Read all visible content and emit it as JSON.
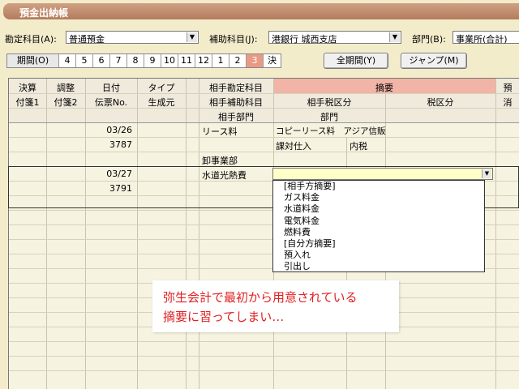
{
  "title": "預金出納帳",
  "fields": {
    "account_label": "勘定科目(A):",
    "account_value": "普通預金",
    "sub_label": "補助科目(J):",
    "sub_value": "港銀行 城西支店",
    "dept_label": "部門(B):",
    "dept_value": "事業所(合計)"
  },
  "period": {
    "label": "期間(O)",
    "months": [
      "4",
      "5",
      "6",
      "7",
      "8",
      "9",
      "10",
      "11",
      "12",
      "1",
      "2",
      "3",
      "決"
    ],
    "selected": "3"
  },
  "buttons": {
    "all_period": "全期間(Y)",
    "jump": "ジャンプ(M)"
  },
  "columns": {
    "row1": [
      "決算",
      "調整",
      "日付",
      "タイプ",
      "相手勘定科目",
      "摘要"
    ],
    "row2": [
      "付箋1",
      "付箋2",
      "伝票No.",
      "生成元",
      "相手補助科目",
      "相手税区分",
      "税区分"
    ],
    "row3": [
      "相手部門",
      "部門"
    ],
    "edge_row1": "預",
    "edge_row2": "消"
  },
  "entries": [
    {
      "date": "03/26",
      "voucher": "3787",
      "account": "リース料",
      "summary": "コピーリース料　アジア信販",
      "tax_class": "課対仕入",
      "tax_type": "内税",
      "dept": "卸事業部"
    },
    {
      "date": "03/27",
      "voucher": "3791",
      "account": "水道光熱費"
    }
  ],
  "dropdown_items": [
    "[相手方摘要]",
    "ガス料金",
    "水道料金",
    "電気料金",
    "燃料費",
    "[自分方摘要]",
    "預入れ",
    "引出し"
  ],
  "callout": {
    "line1": "弥生会計で最初から用意されている",
    "line2": "摘要に習ってしまい…"
  }
}
